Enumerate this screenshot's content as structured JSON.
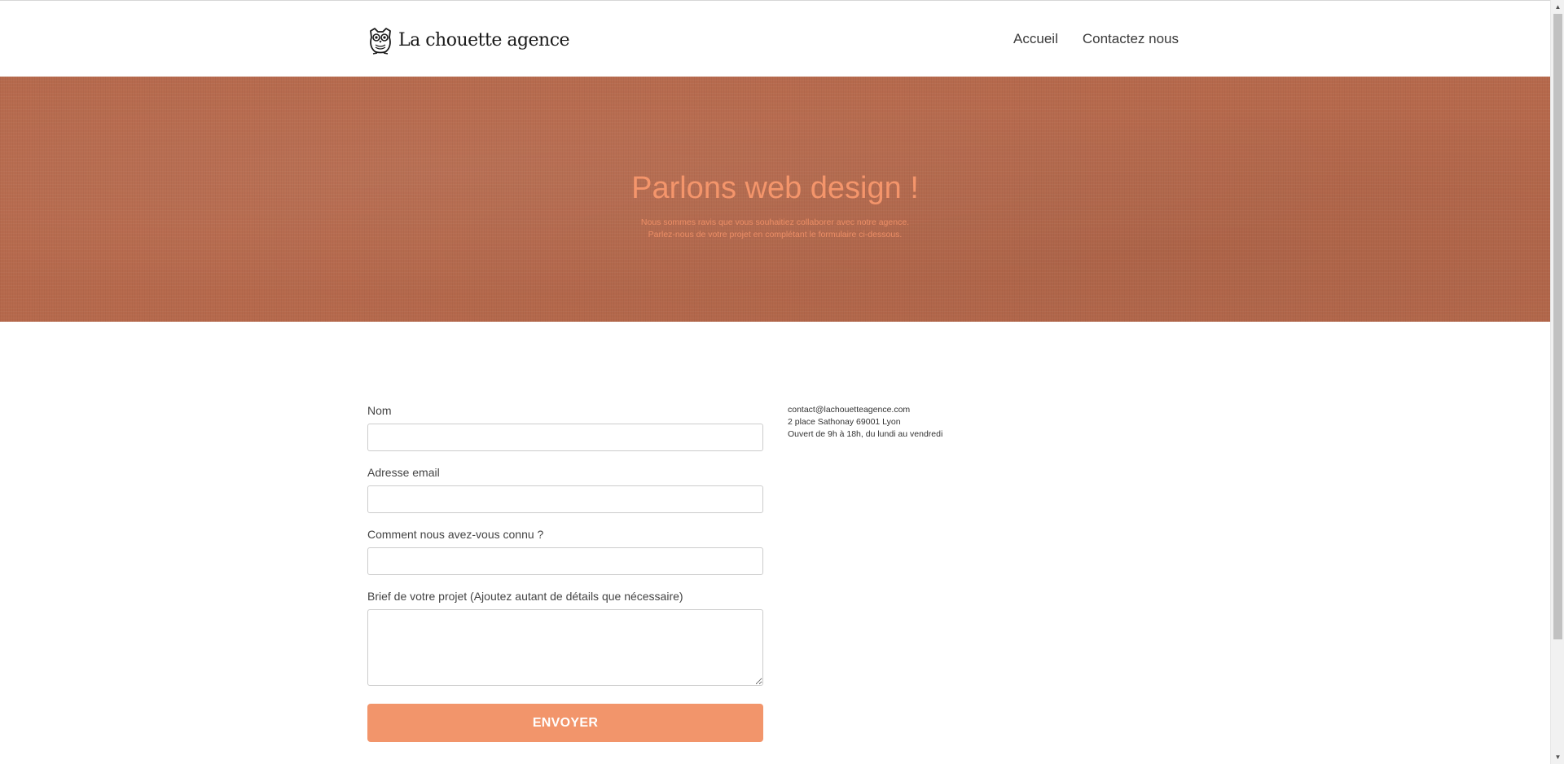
{
  "header": {
    "logo_text": "La chouette agence",
    "nav": [
      {
        "label": "Accueil"
      },
      {
        "label": "Contactez nous"
      }
    ]
  },
  "hero": {
    "title": "Parlons web design !",
    "subtitle_line1": "Nous sommes ravis que vous souhaitiez collaborer avec notre agence.",
    "subtitle_line2": "Parlez-nous de votre projet en complétant le formulaire ci-dessous."
  },
  "form": {
    "name_label": "Nom",
    "name_value": "",
    "email_label": "Adresse email",
    "email_value": "",
    "source_label": "Comment nous avez-vous connu ?",
    "source_value": "",
    "brief_label": "Brief de votre projet (Ajoutez autant de détails que nécessaire)",
    "brief_value": "",
    "submit_label": "ENVOYER"
  },
  "contact": {
    "email": "contact@lachouetteagence.com",
    "address": "2 place Sathonay 69001 Lyon",
    "hours": "Ouvert de 9h à 18h, du lundi au vendredi"
  },
  "colors": {
    "accent": "#f2956b",
    "hero_bg": "#b6694c",
    "hero_text": "#f4956b"
  },
  "icons": {
    "logo": "owl-icon",
    "scroll_up": "scroll-up-arrow-icon",
    "scroll_down": "scroll-down-arrow-icon"
  }
}
